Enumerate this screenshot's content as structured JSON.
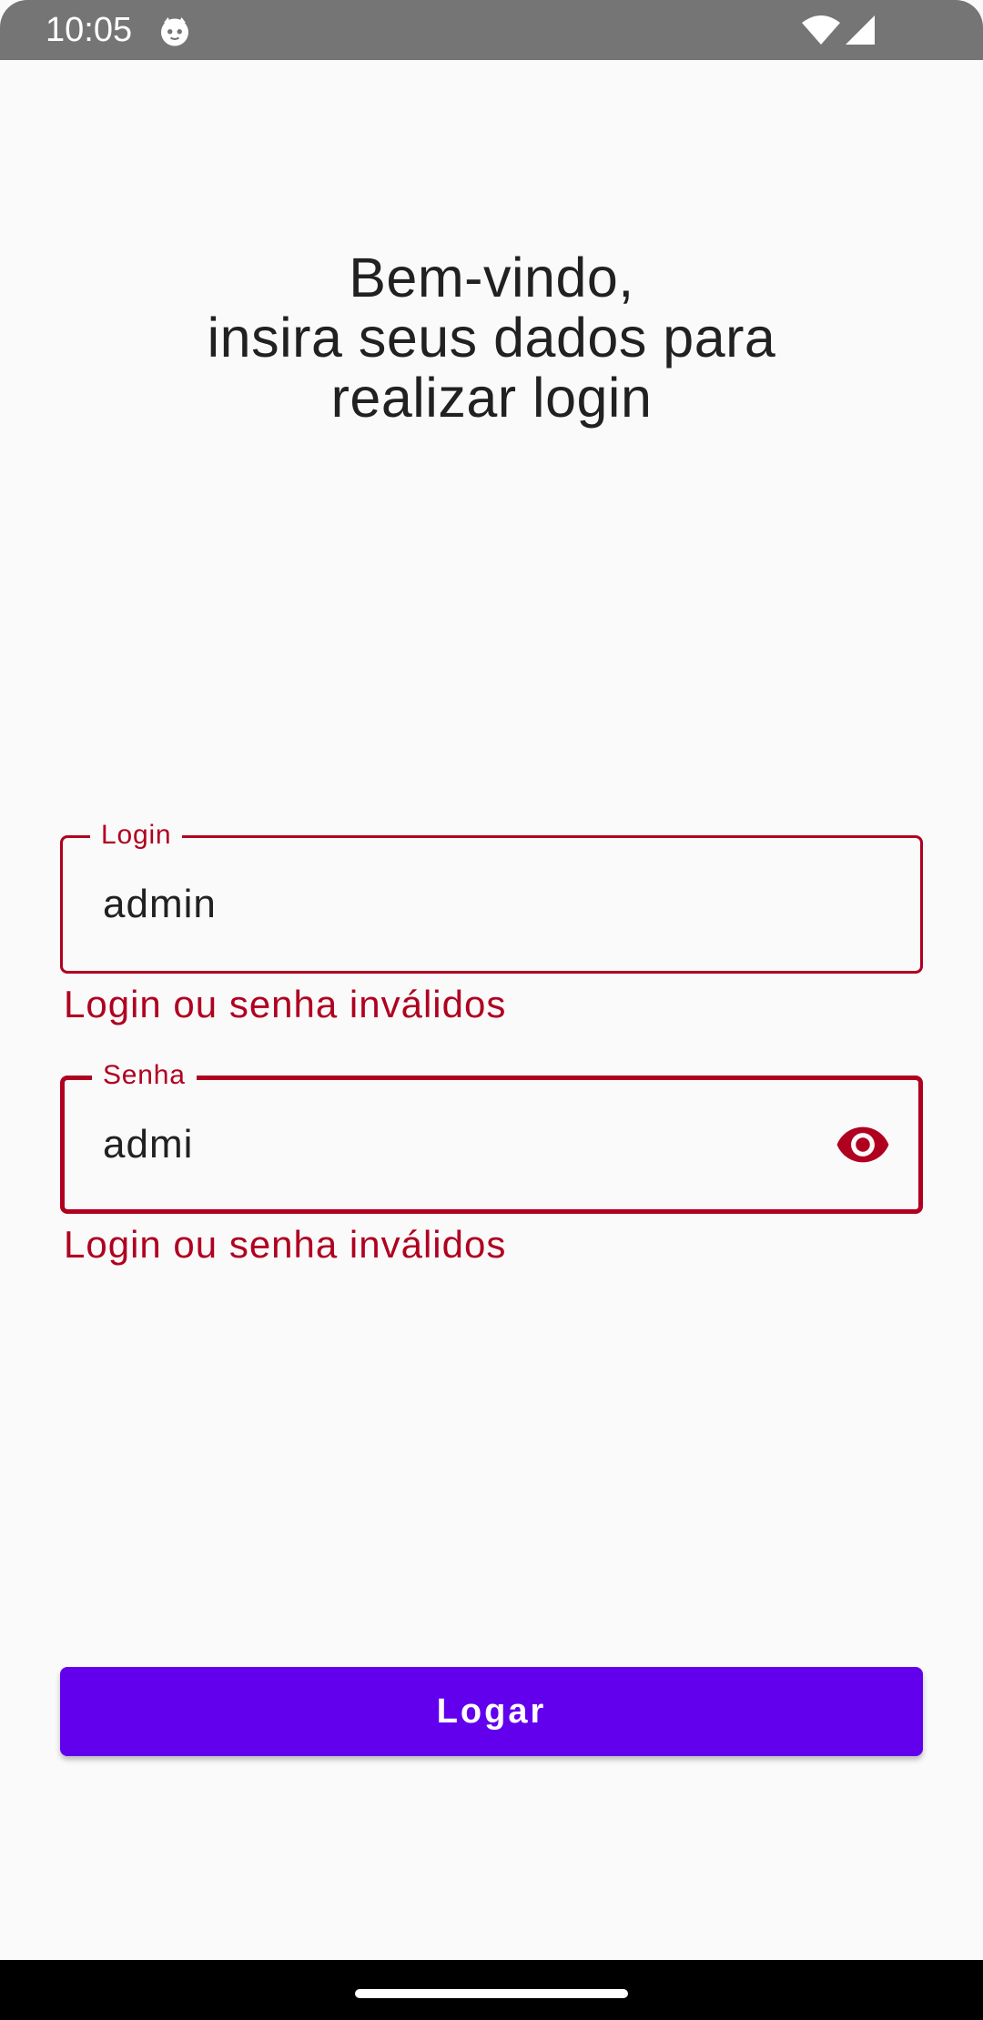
{
  "status_bar": {
    "time": "10:05",
    "icons": [
      "cat-notification-icon",
      "wifi-icon",
      "signal-icon"
    ]
  },
  "welcome": {
    "line1": "Bem-vindo,",
    "line2": "insira seus dados para",
    "line3": "realizar login"
  },
  "login_field": {
    "label": "Login",
    "value": "admin",
    "error": "Login ou senha inválidos"
  },
  "password_field": {
    "label": "Senha",
    "value": "admi",
    "error": "Login ou senha inválidos",
    "toggle_icon": "eye-icon"
  },
  "button": {
    "label": "Logar"
  },
  "colors": {
    "error": "#b00020",
    "primary": "#6200ee",
    "status_bar": "#757575",
    "background": "#fafafa"
  }
}
